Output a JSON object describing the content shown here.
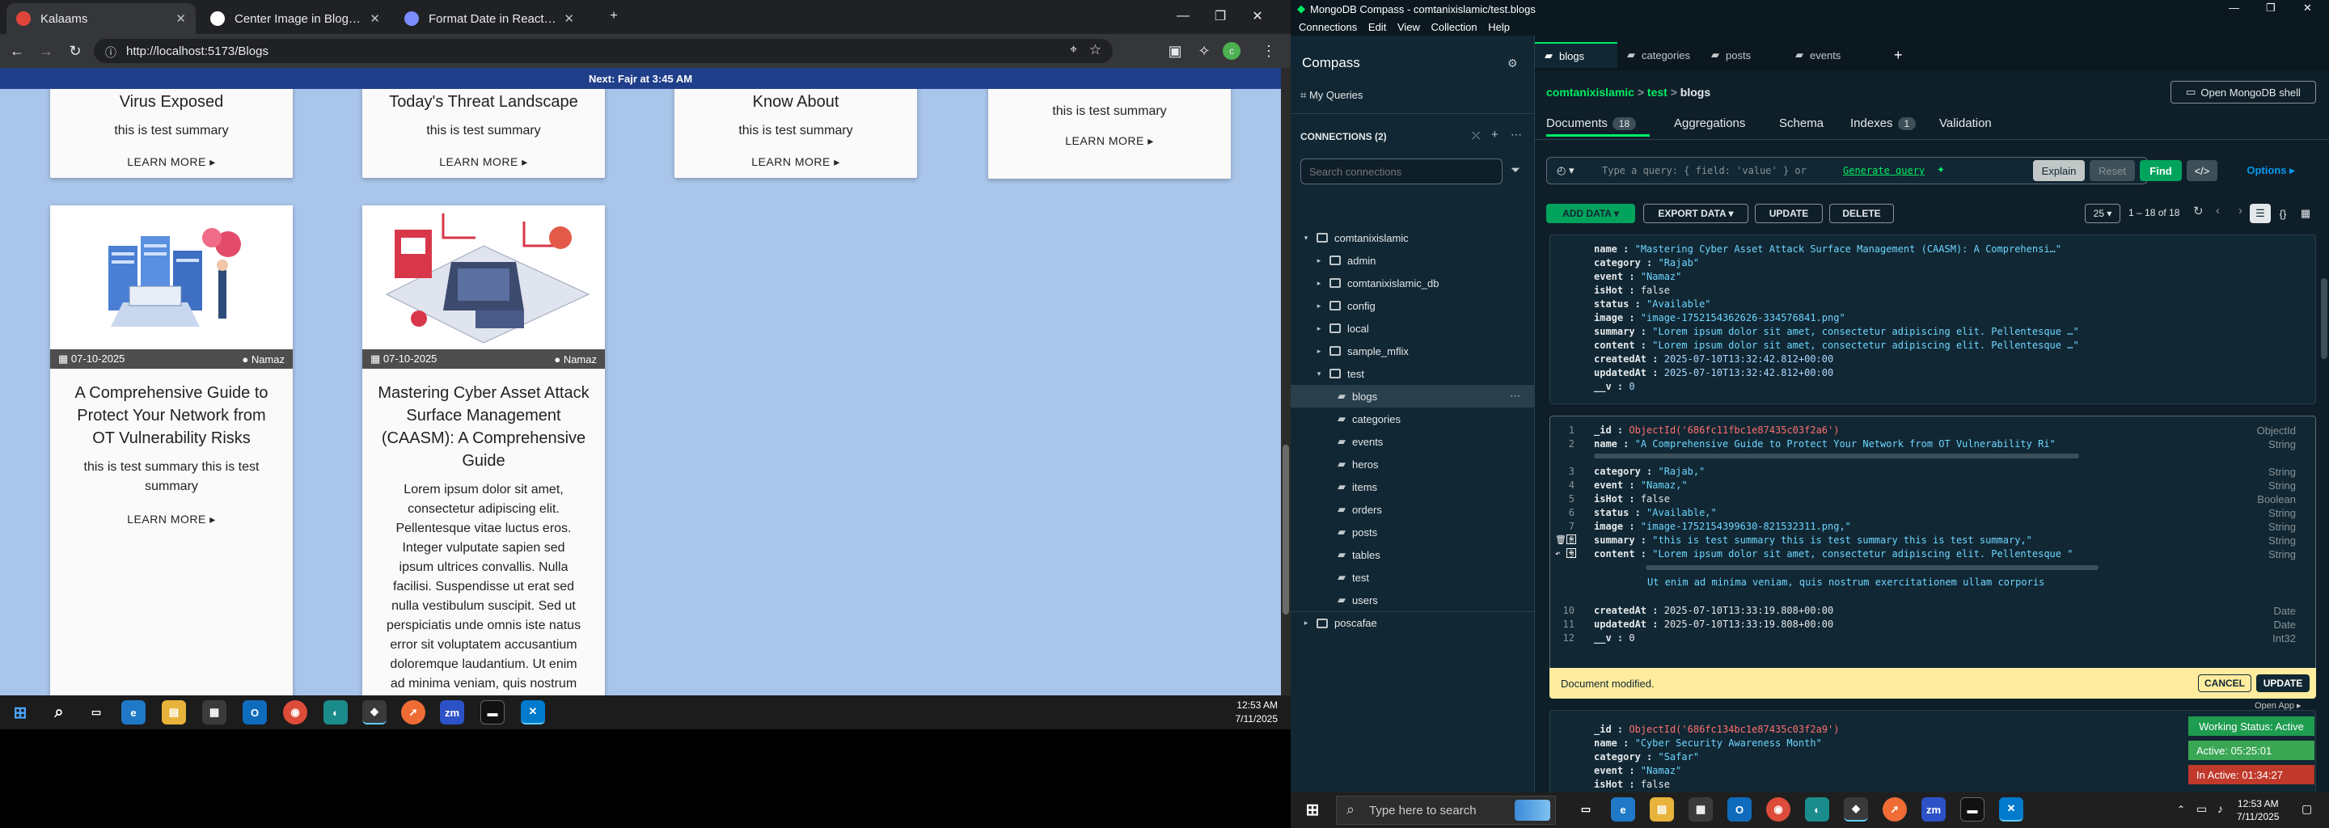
{
  "browser": {
    "tabs": [
      {
        "label": "Kalaams",
        "favicon_color": "#e0453a"
      },
      {
        "label": "Center Image in BlogCard",
        "favicon_color": "#ffffff"
      },
      {
        "label": "Format Date in React Compone",
        "favicon_color": "#7a8cff"
      }
    ],
    "url": "http://localhost:5173/Blogs",
    "banner": "Next: Fajr at 3:45 AM"
  },
  "blog": {
    "top_cards": [
      {
        "title": "Virus Exposed",
        "summary": "this is test summary",
        "more": "LEARN MORE ▸"
      },
      {
        "title": "Today's Threat Landscape",
        "summary": "this is test summary",
        "more": "LEARN MORE ▸"
      },
      {
        "title": "Know About",
        "summary": "this is test summary",
        "more": "LEARN MORE ▸"
      },
      {
        "title": "",
        "summary": "this is test summary",
        "more": "LEARN MORE ▸"
      }
    ],
    "cards": [
      {
        "date": "07-10-2025",
        "event": "Namaz",
        "title": "A Comprehensive Guide to Protect Your Network from OT Vulnerability Risks",
        "summary": "this is test summary this is test summary",
        "more": "LEARN MORE ▸"
      },
      {
        "date": "07-10-2025",
        "event": "Namaz",
        "title": "Mastering Cyber Asset Attack Surface Management (CAASM): A Comprehensive Guide",
        "summary": "Lorem ipsum dolor sit amet, consectetur adipiscing elit. Pellentesque vitae luctus eros. Integer vulputate sapien sed ipsum ultrices convallis. Nulla facilisi. Suspendisse ut erat sed nulla vestibulum suscipit. Sed ut perspiciatis unde omnis iste natus error sit voluptatem accusantium doloremque laudantium. Ut enim ad minima veniam, quis nostrum"
      }
    ]
  },
  "taskbar_left": {
    "time": "12:53 AM",
    "date": "7/11/2025"
  },
  "compass": {
    "window_title": "MongoDB Compass - comtanixislamic/test.blogs",
    "menu": [
      "Connections",
      "Edit",
      "View",
      "Collection",
      "Help"
    ],
    "app_name": "Compass",
    "my_queries": "My Queries",
    "connections_label": "CONNECTIONS (2)",
    "search_placeholder": "Search connections",
    "tree": {
      "cluster": "comtanixislamic",
      "databases": [
        "admin",
        "comtanixislamic_db",
        "config",
        "local",
        "sample_mflix",
        "test"
      ],
      "collections": [
        "blogs",
        "categories",
        "events",
        "heros",
        "items",
        "orders",
        "posts",
        "tables",
        "test",
        "users"
      ],
      "second_cluster": "poscafae"
    },
    "tabs": [
      "blogs",
      "categories",
      "posts",
      "events"
    ],
    "breadcrumb": [
      "comtanixislamic",
      "test",
      "blogs"
    ],
    "open_shell": "Open MongoDB shell",
    "subtabs": {
      "documents": "Documents",
      "documents_count": "18",
      "aggregations": "Aggregations",
      "schema": "Schema",
      "indexes": "Indexes",
      "indexes_count": "1",
      "validation": "Validation"
    },
    "query_placeholder": "Type a query: { field: 'value' } or",
    "generate_query": "Generate query",
    "buttons": {
      "explain": "Explain",
      "reset": "Reset",
      "find": "Find",
      "options": "Options ▸",
      "add_data": "ADD DATA ▾",
      "export_data": "EXPORT DATA ▾",
      "update": "UPDATE",
      "delete": "DELETE"
    },
    "page_size": "25 ▾",
    "range": "1 – 18 of 18",
    "doc1": [
      {
        "key": "name",
        "value": "\"Mastering Cyber Asset Attack Surface Management (CAASM): A Comprehensi…\"",
        "cls": "fstr"
      },
      {
        "key": "category",
        "value": "\"Rajab\"",
        "cls": "fstr"
      },
      {
        "key": "event",
        "value": "\"Namaz\"",
        "cls": "fstr"
      },
      {
        "key": "isHot",
        "value": "false",
        "cls": "fbool"
      },
      {
        "key": "status",
        "value": "\"Available\"",
        "cls": "fstr"
      },
      {
        "key": "image",
        "value": "\"image-1752154362626-334576841.png\"",
        "cls": "fstr"
      },
      {
        "key": "summary",
        "value": "\"Lorem ipsum dolor sit amet, consectetur adipiscing elit. Pellentesque …\"",
        "cls": "fstr"
      },
      {
        "key": "content",
        "value": "\"Lorem ipsum dolor sit amet, consectetur adipiscing elit. Pellentesque …\"",
        "cls": "fstr"
      },
      {
        "key": "createdAt",
        "value": "2025-07-10T13:32:42.812+00:00",
        "cls": "fnum"
      },
      {
        "key": "updatedAt",
        "value": "2025-07-10T13:32:42.812+00:00",
        "cls": "fnum"
      },
      {
        "key": "__v",
        "value": "0",
        "cls": "fnum"
      }
    ],
    "doc2": [
      {
        "n": "1",
        "key": "_id",
        "value": "ObjectId('686fc11fbc1e87435c03f2a6')",
        "cls": "foid",
        "type": "ObjectId"
      },
      {
        "n": "2",
        "key": "name",
        "value": "\"A Comprehensive Guide to Protect Your Network from OT Vulnerability Ri\"",
        "cls": "fstr",
        "type": "String"
      },
      {
        "n": "3",
        "key": "category",
        "value": "\"Rajab,\"",
        "cls": "fstr",
        "type": "String"
      },
      {
        "n": "4",
        "key": "event",
        "value": "\"Namaz,\"",
        "cls": "fstr",
        "type": "String"
      },
      {
        "n": "5",
        "key": "isHot",
        "value": "false",
        "cls": "fbool",
        "type": "Boolean"
      },
      {
        "n": "6",
        "key": "status",
        "value": "\"Available,\"",
        "cls": "fstr",
        "type": "String"
      },
      {
        "n": "7",
        "key": "image",
        "value": "\"image-1752154399630-821532311.png,\"",
        "cls": "fstr",
        "type": "String"
      },
      {
        "n": "8",
        "key": "summary",
        "value": "\"this is test summary this is test summary this is test summary,\"",
        "cls": "fstr",
        "type": "String"
      },
      {
        "n": "9",
        "key": "content",
        "value": "\"Lorem ipsum dolor sit amet, consectetur adipiscing elit. Pellentesque \"",
        "cls": "fstr",
        "type": "String"
      },
      {
        "n": "",
        "key": "",
        "value": "Ut enim ad minima veniam, quis nostrum exercitationem ullam corporis",
        "cls": "fstr",
        "type": ""
      },
      {
        "n": "10",
        "key": "createdAt",
        "value": "2025-07-10T13:33:19.808+00:00",
        "cls": "fbool",
        "type": "Date"
      },
      {
        "n": "11",
        "key": "updatedAt",
        "value": "2025-07-10T13:33:19.808+00:00",
        "cls": "fbool",
        "type": "Date"
      },
      {
        "n": "12",
        "key": "__v",
        "value": "0",
        "cls": "fbool",
        "type": "Int32"
      }
    ],
    "modified_text": "Document modified.",
    "cancel": "CANCEL",
    "update_btn": "UPDATE",
    "open_app": "Open App ▸",
    "doc3": [
      {
        "key": "_id",
        "value": "ObjectId('686fc134bc1e87435c03f2a9')",
        "cls": "foid"
      },
      {
        "key": "name",
        "value": "\"Cyber Security Awareness Month\"",
        "cls": "fstr"
      },
      {
        "key": "category",
        "value": "\"Safar\"",
        "cls": "fstr"
      },
      {
        "key": "event",
        "value": "\"Namaz\"",
        "cls": "fstr"
      },
      {
        "key": "isHot",
        "value": "false",
        "cls": "fbool"
      }
    ],
    "status_widgets": {
      "working": "Working Status: Active",
      "active": "Active: 05:25:01",
      "inactive": "In Active: 01:34:27"
    }
  },
  "taskbar_right": {
    "search_placeholder": "Type here to search",
    "time": "12:53 AM",
    "date": "7/11/2025"
  }
}
